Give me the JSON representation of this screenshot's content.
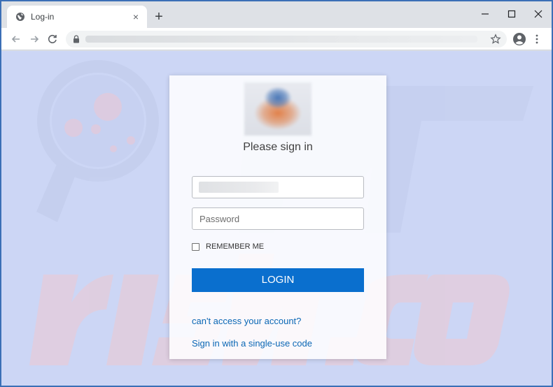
{
  "browser": {
    "tab_title": "Log-in",
    "tab_close_glyph": "×",
    "new_tab_glyph": "+",
    "icons": {
      "tab": "globe-icon",
      "back": "arrow-left-icon",
      "forward": "arrow-right-icon",
      "reload": "reload-icon",
      "lock": "lock-icon",
      "bookmark": "star-icon",
      "profile": "profile-icon",
      "menu": "kebab-menu-icon",
      "minimize": "minimize-icon",
      "maximize": "maximize-icon",
      "close": "close-icon"
    },
    "frame_color": "#3b6fb6"
  },
  "page": {
    "background_color": "#ccd6f5",
    "login": {
      "heading": "Please sign in",
      "username_placeholder": "",
      "password_placeholder": "Password",
      "remember_label": "REMEMBER ME",
      "remember_checked": false,
      "login_button": "LOGIN",
      "login_button_color": "#0a6fce",
      "access_link": "can't access your account?",
      "code_link": "Sign in with a single-use code",
      "link_color": "#0a67b5"
    }
  }
}
